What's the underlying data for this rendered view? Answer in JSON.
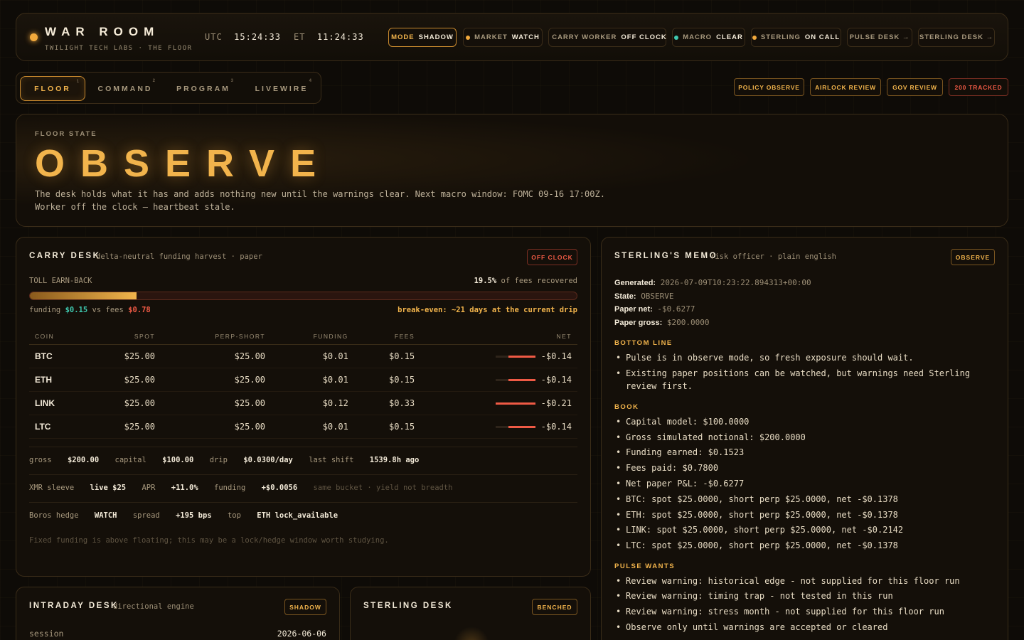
{
  "header": {
    "title": "WAR ROOM",
    "subtitle": "TWILIGHT TECH LABS · THE FLOOR",
    "utc_label": "UTC",
    "utc_time": "15:24:33",
    "et_label": "ET",
    "et_time": "11:24:33",
    "pills": [
      {
        "label": "MODE",
        "value": "SHADOW"
      },
      {
        "label": "MARKET",
        "value": "WATCH",
        "dot": "#f2a93c"
      },
      {
        "label": "CARRY WORKER",
        "value": "OFF CLOCK",
        "dot": "#6d604c"
      },
      {
        "label": "MACRO",
        "value": "CLEAR",
        "dot": "#3fc9b0"
      },
      {
        "label": "STERLING",
        "value": "ON CALL",
        "dot": "#f2a93c"
      },
      {
        "label": "PULSE DESK →",
        "value": ""
      },
      {
        "label": "STERLING DESK →",
        "value": ""
      }
    ]
  },
  "tabs": [
    {
      "label": "FLOOR",
      "num": "1"
    },
    {
      "label": "COMMAND",
      "num": "2"
    },
    {
      "label": "PROGRAM",
      "num": "3"
    },
    {
      "label": "LIVEWIRE",
      "num": "4"
    }
  ],
  "right_buttons": [
    "POLICY OBSERVE",
    "AIRLOCK REVIEW",
    "GOV REVIEW",
    "200 TRACKED"
  ],
  "hero": {
    "label": "FLOOR STATE",
    "state": "OBSERVE",
    "line1": "The desk holds what it has and adds nothing new until the warnings clear. Next macro window: FOMC 09-16 17:00Z.",
    "line2": "Worker off the clock — heartbeat stale."
  },
  "carry": {
    "title": "CARRY DESK",
    "sub": "delta-neutral funding harvest · paper",
    "badge": "OFF CLOCK",
    "toll_label": "TOLL EARN-BACK",
    "toll_pct": "19.5%",
    "toll_pct_value": 19.5,
    "toll_suffix": "of fees recovered",
    "funding_label": "funding",
    "funding_val": "$0.15",
    "vs_fees": "vs fees",
    "fees_val": "$0.78",
    "breakeven": "break-even: ~21 days at the current drip",
    "columns": [
      "COIN",
      "SPOT",
      "PERP-SHORT",
      "FUNDING",
      "FEES",
      "NET"
    ],
    "rows": [
      {
        "coin": "BTC",
        "spot": "$25.00",
        "perp": "$25.00",
        "funding": "$0.01",
        "fees": "$0.15",
        "net": "-$0.14",
        "net_value": -0.14
      },
      {
        "coin": "ETH",
        "spot": "$25.00",
        "perp": "$25.00",
        "funding": "$0.01",
        "fees": "$0.15",
        "net": "-$0.14",
        "net_value": -0.14
      },
      {
        "coin": "LINK",
        "spot": "$25.00",
        "perp": "$25.00",
        "funding": "$0.12",
        "fees": "$0.33",
        "net": "-$0.21",
        "net_value": -0.21
      },
      {
        "coin": "LTC",
        "spot": "$25.00",
        "perp": "$25.00",
        "funding": "$0.01",
        "fees": "$0.15",
        "net": "-$0.14",
        "net_value": -0.14
      }
    ],
    "stats1": {
      "gross_l": "gross",
      "gross": "$200.00",
      "capital_l": "capital",
      "capital": "$100.00",
      "drip_l": "drip",
      "drip": "$0.0300/day",
      "shift_l": "last shift",
      "shift": "1539.8h ago"
    },
    "stats2": {
      "xmr_l": "XMR sleeve",
      "xmr": "live $25",
      "apr_l": "APR",
      "apr": "+11.0%",
      "funding_l": "funding",
      "funding": "+$0.0056",
      "note": "same bucket · yield not breadth"
    },
    "stats3": {
      "boros_l": "Boros hedge",
      "boros": "WATCH",
      "spread_l": "spread",
      "spread": "+195 bps",
      "top_l": "top",
      "top": "ETH lock_available"
    },
    "footnote": "Fixed funding is above floating; this may be a lock/hedge window worth studying."
  },
  "memo": {
    "title": "STERLING'S MEMO",
    "sub": "risk officer · plain english",
    "badge": "OBSERVE",
    "kv": [
      {
        "k": "Generated:",
        "v": "2026-07-09T10:23:22.894313+00:00"
      },
      {
        "k": "State:",
        "v": "OBSERVE"
      },
      {
        "k": "Paper net:",
        "v": "-$0.6277"
      },
      {
        "k": "Paper gross:",
        "v": "$200.0000"
      }
    ],
    "bottom_line_title": "BOTTOM LINE",
    "bottom_line": [
      "Pulse is in observe mode, so fresh exposure should wait.",
      "Existing paper positions can be watched, but warnings need Sterling review first."
    ],
    "book_title": "BOOK",
    "book": [
      "Capital model: $100.0000",
      "Gross simulated notional: $200.0000",
      "Funding earned: $0.1523",
      "Fees paid: $0.7800",
      "Net paper P&L: -$0.6277",
      "BTC: spot $25.0000, short perp $25.0000, net -$0.1378",
      "ETH: spot $25.0000, short perp $25.0000, net -$0.1378",
      "LINK: spot $25.0000, short perp $25.0000, net -$0.2142",
      "LTC: spot $25.0000, short perp $25.0000, net -$0.1378"
    ],
    "pulse_title": "PULSE WANTS",
    "pulse": [
      "Review warning: historical edge - not supplied for this floor run",
      "Review warning: timing trap - not tested in this run",
      "Review warning: stress month - not supplied for this floor run",
      "Observe only until warnings are accepted or cleared"
    ]
  },
  "intraday": {
    "title": "INTRADAY DESK",
    "sub": "directional engine",
    "badge": "SHADOW",
    "session_l": "session",
    "session": "2026-06-06"
  },
  "sterling_desk": {
    "title": "STERLING DESK",
    "badge": "BENCHED"
  }
}
